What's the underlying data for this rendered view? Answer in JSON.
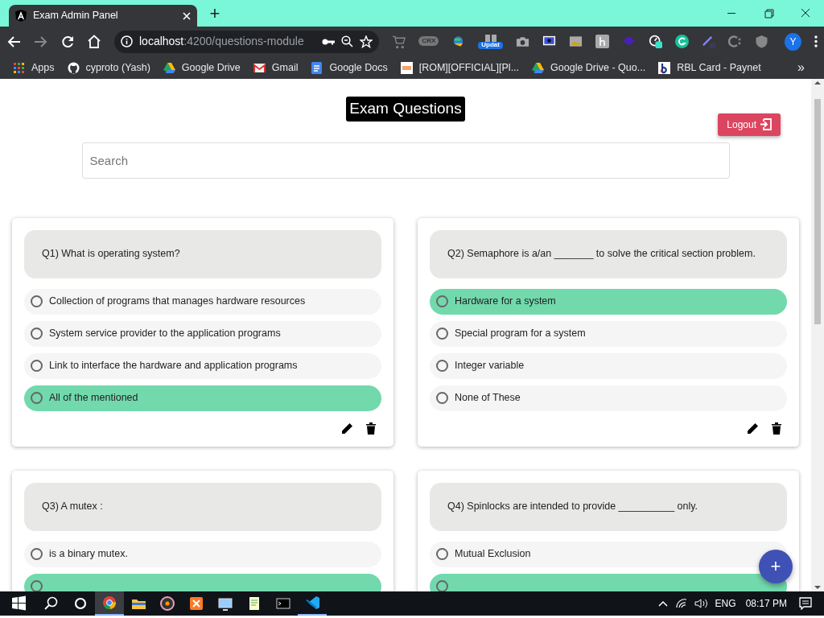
{
  "browser": {
    "tab_title": "Exam Admin Panel",
    "new_tab": "+",
    "address_host": "localhost",
    "address_path": ":4200/questions-module",
    "crx_label": "CRX",
    "update_badge": "Updat",
    "avatar": "Y",
    "bookmarks": [
      {
        "kind": "apps",
        "label": "Apps"
      },
      {
        "kind": "github",
        "label": "cyproto (Yash)"
      },
      {
        "kind": "drive",
        "label": "Google Drive"
      },
      {
        "kind": "gmail",
        "label": "Gmail"
      },
      {
        "kind": "docs",
        "label": "Google Docs"
      },
      {
        "kind": "xda",
        "label": "[ROM][OFFICIAL][Pl..."
      },
      {
        "kind": "drive",
        "label": "Google Drive - Quo..."
      },
      {
        "kind": "rbl",
        "label": "RBL Card - Paynet"
      }
    ],
    "bookmarks_more": "»"
  },
  "page": {
    "title": "Exam Questions",
    "logout": "Logout",
    "search": {
      "placeholder": "Search"
    },
    "add_button": "+",
    "questions": [
      {
        "text": "Q1) What is operating system?",
        "options": [
          {
            "text": "Collection of programs that manages hardware resources",
            "correct": false
          },
          {
            "text": "System service provider to the application programs",
            "correct": false
          },
          {
            "text": "Link to interface the hardware and application programs",
            "correct": false
          },
          {
            "text": "All of the mentioned",
            "correct": true
          }
        ]
      },
      {
        "text": "Q2) Semaphore is a/an _______ to solve the critical section problem.",
        "options": [
          {
            "text": "Hardware for a system",
            "correct": true
          },
          {
            "text": "Special program for a system",
            "correct": false
          },
          {
            "text": "Integer variable",
            "correct": false
          },
          {
            "text": "None of These",
            "correct": false
          }
        ]
      },
      {
        "text": "Q3) A mutex :",
        "options": [
          {
            "text": "is a binary mutex.",
            "correct": false
          },
          {
            "correct": true
          }
        ]
      },
      {
        "text": "Q4) Spinlocks are intended to provide __________ only.",
        "options": [
          {
            "text": "Mutual Exclusion",
            "correct": false
          },
          {
            "correct": true
          }
        ]
      }
    ]
  },
  "taskbar": {
    "language": "ENG",
    "time": "08:17 PM"
  }
}
